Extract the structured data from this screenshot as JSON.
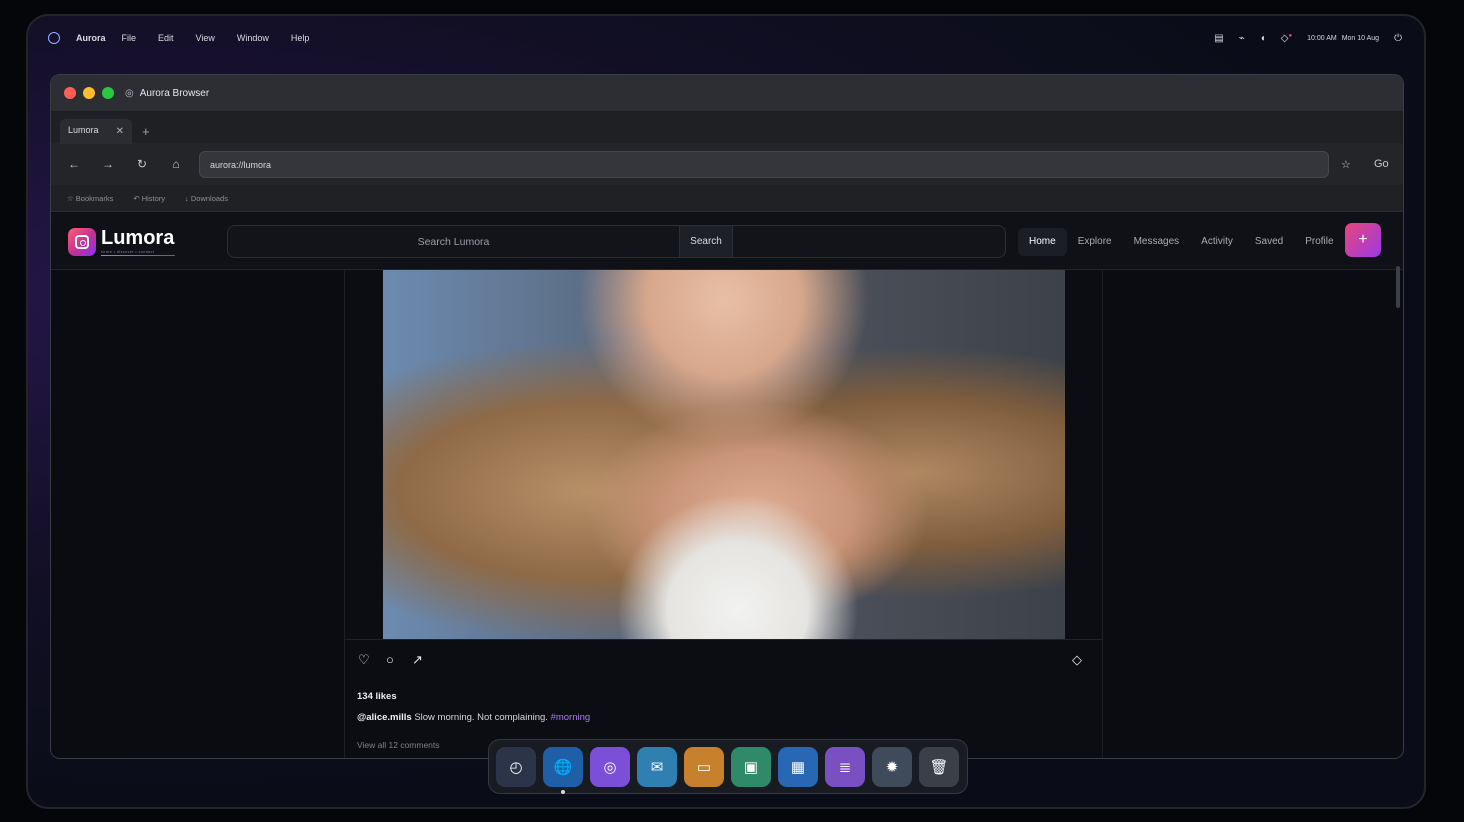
{
  "menubar": {
    "app": "Aurora",
    "menus": [
      "File",
      "Edit",
      "View",
      "Window",
      "Help"
    ],
    "time": "10:00 AM",
    "date": "Mon 10 Aug"
  },
  "browser": {
    "title": "Aurora Browser",
    "tab_label": "Lumora",
    "url": "aurora://lumora",
    "go_label": "Go",
    "bookmarks": [
      "☆ Bookmarks",
      "↶ History",
      "↓ Downloads"
    ]
  },
  "lumora": {
    "brand": "Lumora",
    "tagline": "share • discover • connect",
    "search_placeholder": "Search Lumora",
    "search_button": "Search",
    "nav": [
      "Home",
      "Explore",
      "Messages",
      "Activity",
      "Saved",
      "Profile"
    ],
    "active_nav": "Home",
    "post": {
      "likes": "134 likes",
      "username": "@alice.mills",
      "caption": "Slow morning. Not complaining.",
      "hashtag": "#morning",
      "view_comments": "View all 12 comments"
    }
  },
  "dock": {
    "apps": [
      {
        "name": "launcher",
        "icon": "◴",
        "color": "#2b3448"
      },
      {
        "name": "browser",
        "icon": "🌐",
        "color": "#1f5fa8",
        "running": true
      },
      {
        "name": "lumora",
        "icon": "◎",
        "color": "#7b4fd8"
      },
      {
        "name": "mail",
        "icon": "✉",
        "color": "#2f7fb0"
      },
      {
        "name": "files",
        "icon": "▭",
        "color": "#c7812c"
      },
      {
        "name": "photos",
        "icon": "▣",
        "color": "#2f8a6a"
      },
      {
        "name": "calendar",
        "icon": "▦",
        "color": "#2867b4"
      },
      {
        "name": "notes",
        "icon": "≣",
        "color": "#7a4fc2"
      },
      {
        "name": "settings",
        "icon": "✹",
        "color": "#3f4a5a"
      },
      {
        "name": "trash",
        "icon": "🗑",
        "color": "#3a3f48"
      }
    ]
  },
  "colors": {
    "accent": "#9b3ae6",
    "hashtag": "#a97cf0"
  }
}
